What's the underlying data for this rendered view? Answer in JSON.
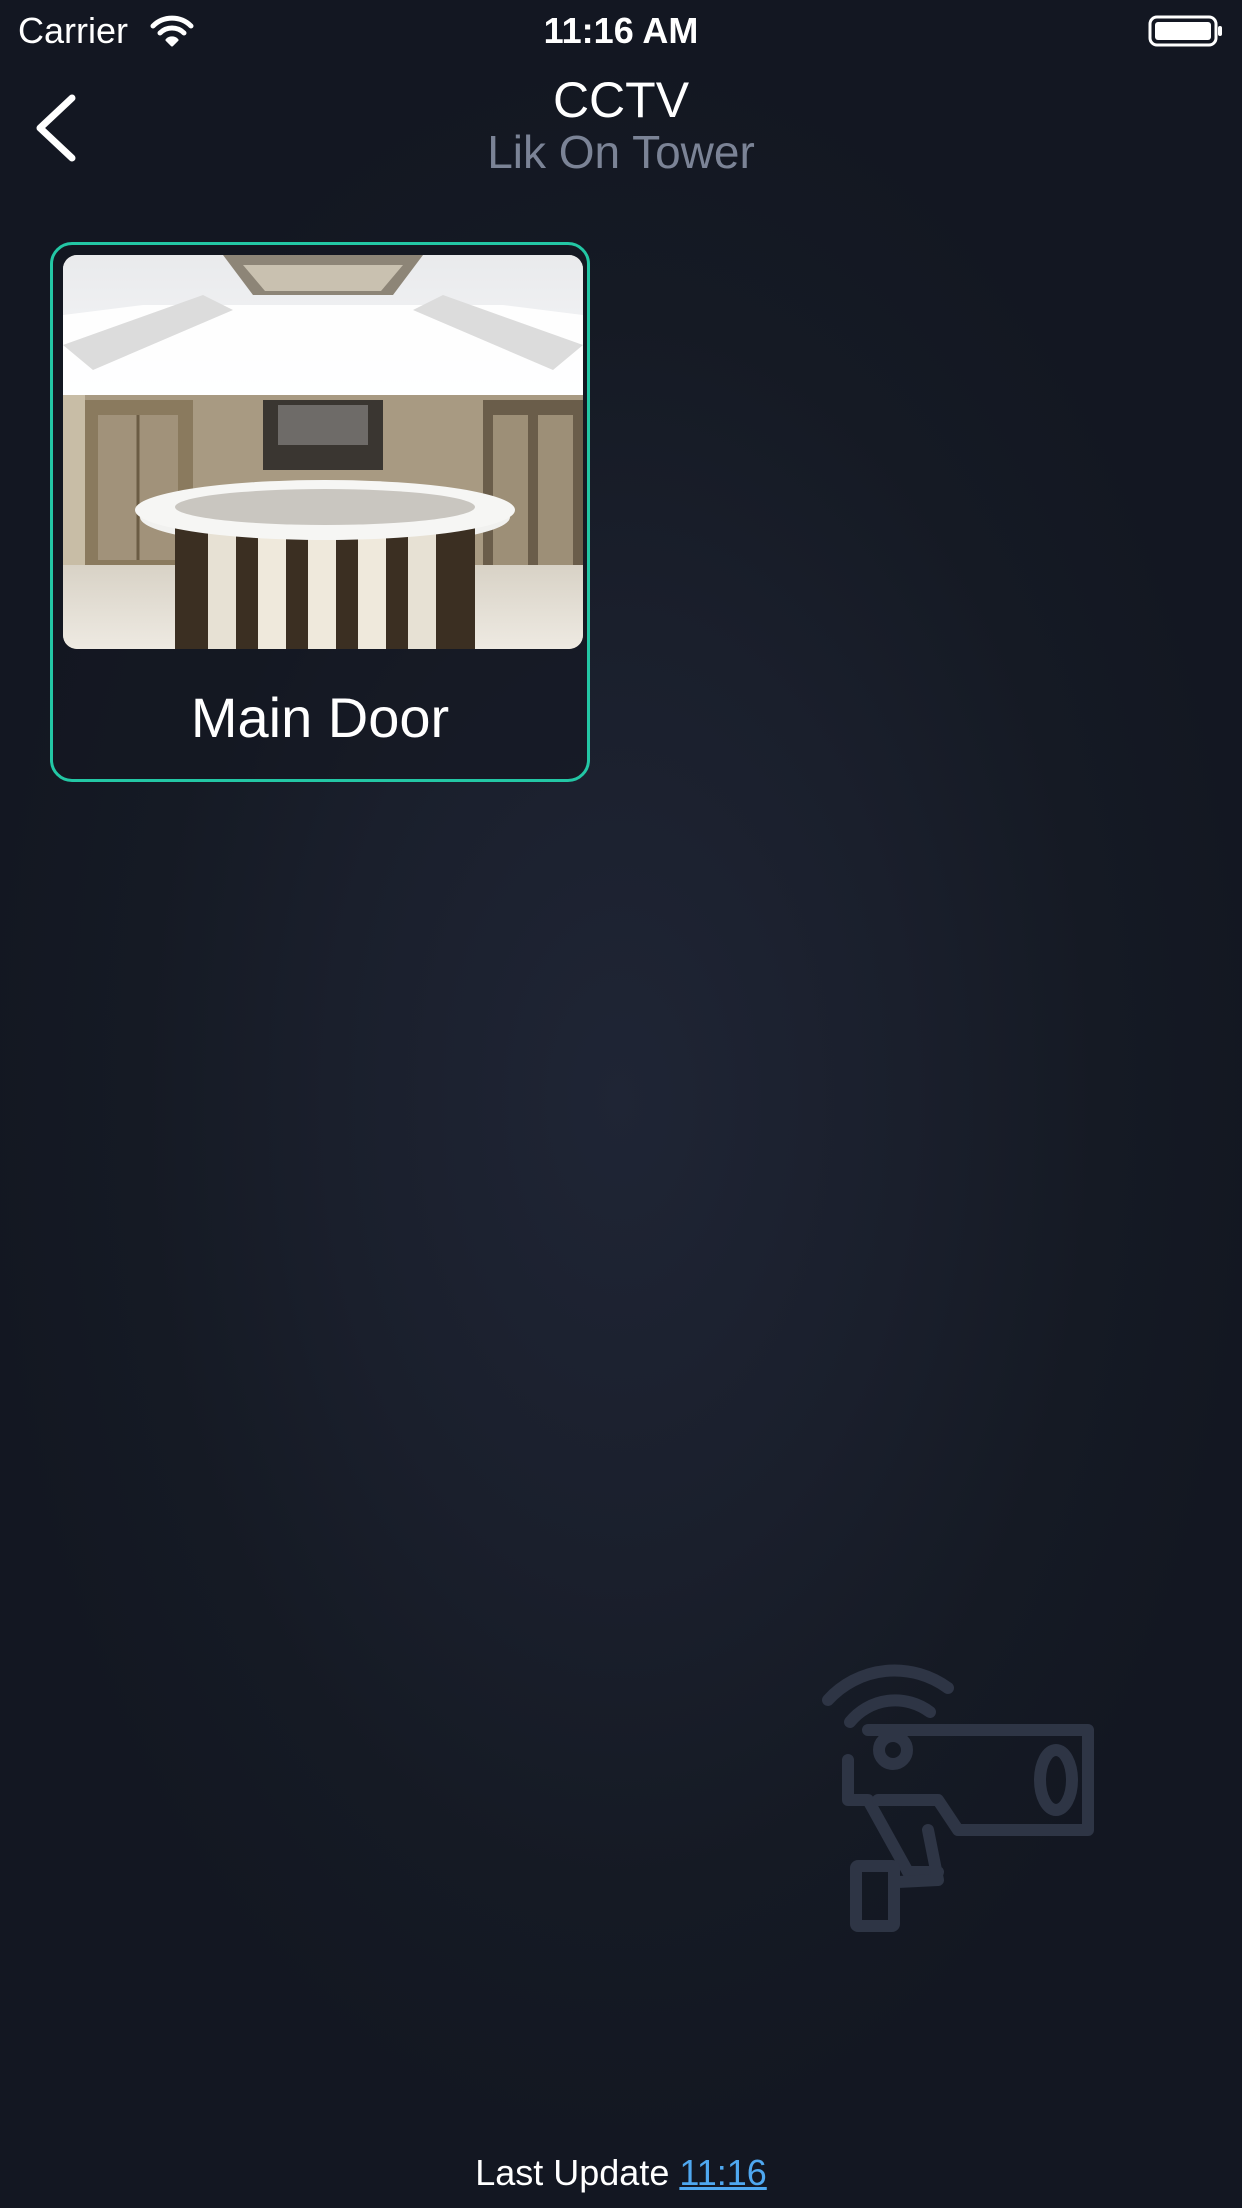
{
  "status_bar": {
    "carrier": "Carrier",
    "time": "11:16 AM"
  },
  "nav": {
    "title": "CCTV",
    "subtitle": "Lik On Tower",
    "back_icon": "chevron-left-icon"
  },
  "cameras": [
    {
      "name": "Main Door"
    }
  ],
  "footer": {
    "label": "Last Update",
    "time": "11:16"
  },
  "colors": {
    "accent": "#23c7a5",
    "link": "#4fa8f0",
    "subtitle": "#7b8396",
    "background": "#171b26"
  }
}
